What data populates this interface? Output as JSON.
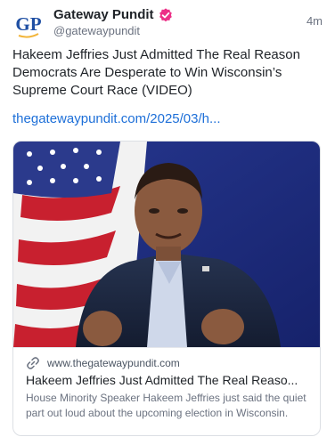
{
  "author": {
    "display_name": "Gateway Pundit",
    "handle": "@gatewaypundit",
    "avatar_text": "GP",
    "verified_icon": "verified-badge-icon"
  },
  "timestamp": "4m",
  "post": {
    "text": "Hakeem Jeffries Just Admitted The Real Reason Democrats Are Desperate to Win Wisconsin’s Supreme Court Race (VIDEO)",
    "link_text": "thegatewaypundit.com/2025/03/h..."
  },
  "link_card": {
    "domain": "www.thegatewaypundit.com",
    "title": "Hakeem Jeffries Just Admitted The Real Reaso...",
    "description": "House Minority Speaker Hakeem Jeffries just said the quiet part out loud about the upcoming election in Wisconsin.",
    "icon": "link-icon"
  },
  "colors": {
    "brand_blue": "#1f4fa3",
    "verified_pink": "#ec2f87",
    "link_blue": "#1d6fd8"
  }
}
